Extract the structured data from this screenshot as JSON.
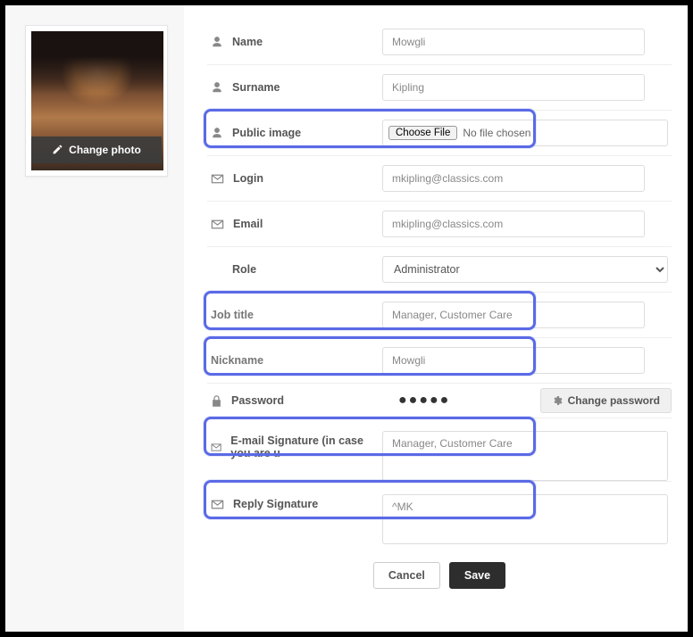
{
  "sidebar": {
    "change_photo_label": "Change photo"
  },
  "form": {
    "name": {
      "label": "Name",
      "value": "Mowgli"
    },
    "surname": {
      "label": "Surname",
      "value": "Kipling"
    },
    "public_image": {
      "label": "Public image",
      "button": "Choose File",
      "status": "No file chosen"
    },
    "login": {
      "label": "Login",
      "value": "mkipling@classics.com"
    },
    "email": {
      "label": "Email",
      "value": "mkipling@classics.com"
    },
    "role": {
      "label": "Role",
      "value": "Administrator"
    },
    "job_title": {
      "label": "Job title",
      "value": "Manager, Customer Care"
    },
    "nickname": {
      "label": "Nickname",
      "value": "Mowgli"
    },
    "password": {
      "label": "Password",
      "masked": "●●●●●",
      "change_label": "Change password"
    },
    "email_signature": {
      "label": "E-mail Signature (in case you are u",
      "value": "Manager, Customer Care"
    },
    "reply_signature": {
      "label": "Reply Signature",
      "value": "^MK"
    }
  },
  "footer": {
    "cancel": "Cancel",
    "save": "Save"
  }
}
